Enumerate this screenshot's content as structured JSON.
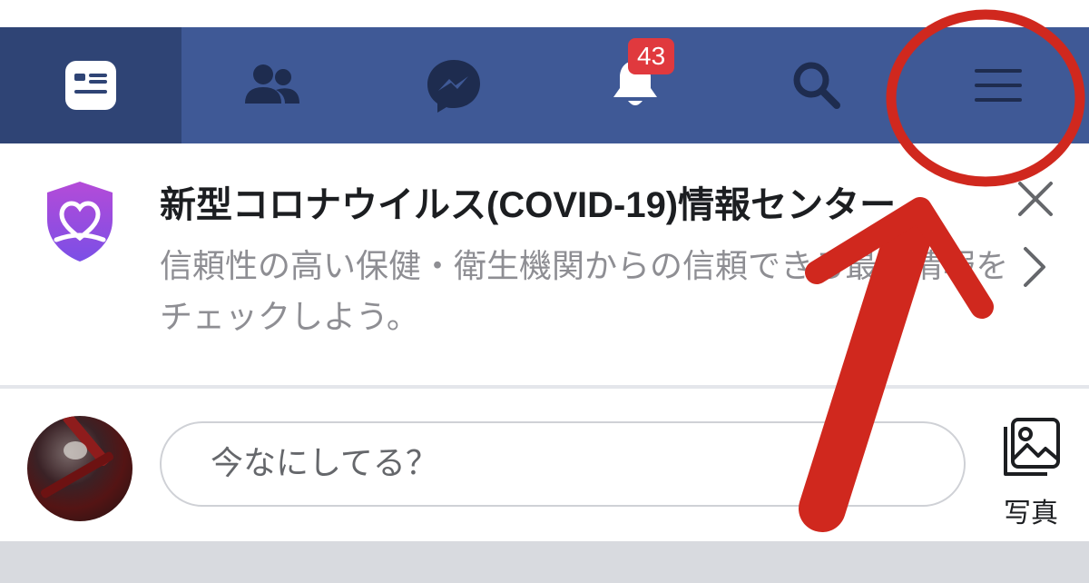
{
  "navbar": {
    "tabs": [
      {
        "name": "news-feed",
        "icon": "news-feed-icon",
        "active": true
      },
      {
        "name": "friends",
        "icon": "friends-icon",
        "active": false
      },
      {
        "name": "messenger",
        "icon": "messenger-icon",
        "active": false
      },
      {
        "name": "notifications",
        "icon": "bell-icon",
        "active": false,
        "badge": "43"
      },
      {
        "name": "search",
        "icon": "search-icon",
        "active": false
      },
      {
        "name": "menu",
        "icon": "hamburger-menu-icon",
        "active": false
      }
    ]
  },
  "covid_card": {
    "title": "新型コロナウイルス(COVID-19)情報センター",
    "description": "信頼性の高い保健・衛生機関からの信頼できる最新情報をチェックしよう。",
    "icon": "covid-shield-heart-icon"
  },
  "composer": {
    "placeholder": "今なにしてる？",
    "photo_label": "写真"
  },
  "colors": {
    "navbar": "#3f5996",
    "navbar_active": "#2f4475",
    "badge": "#e0393e",
    "annotation": "#d0281e"
  }
}
